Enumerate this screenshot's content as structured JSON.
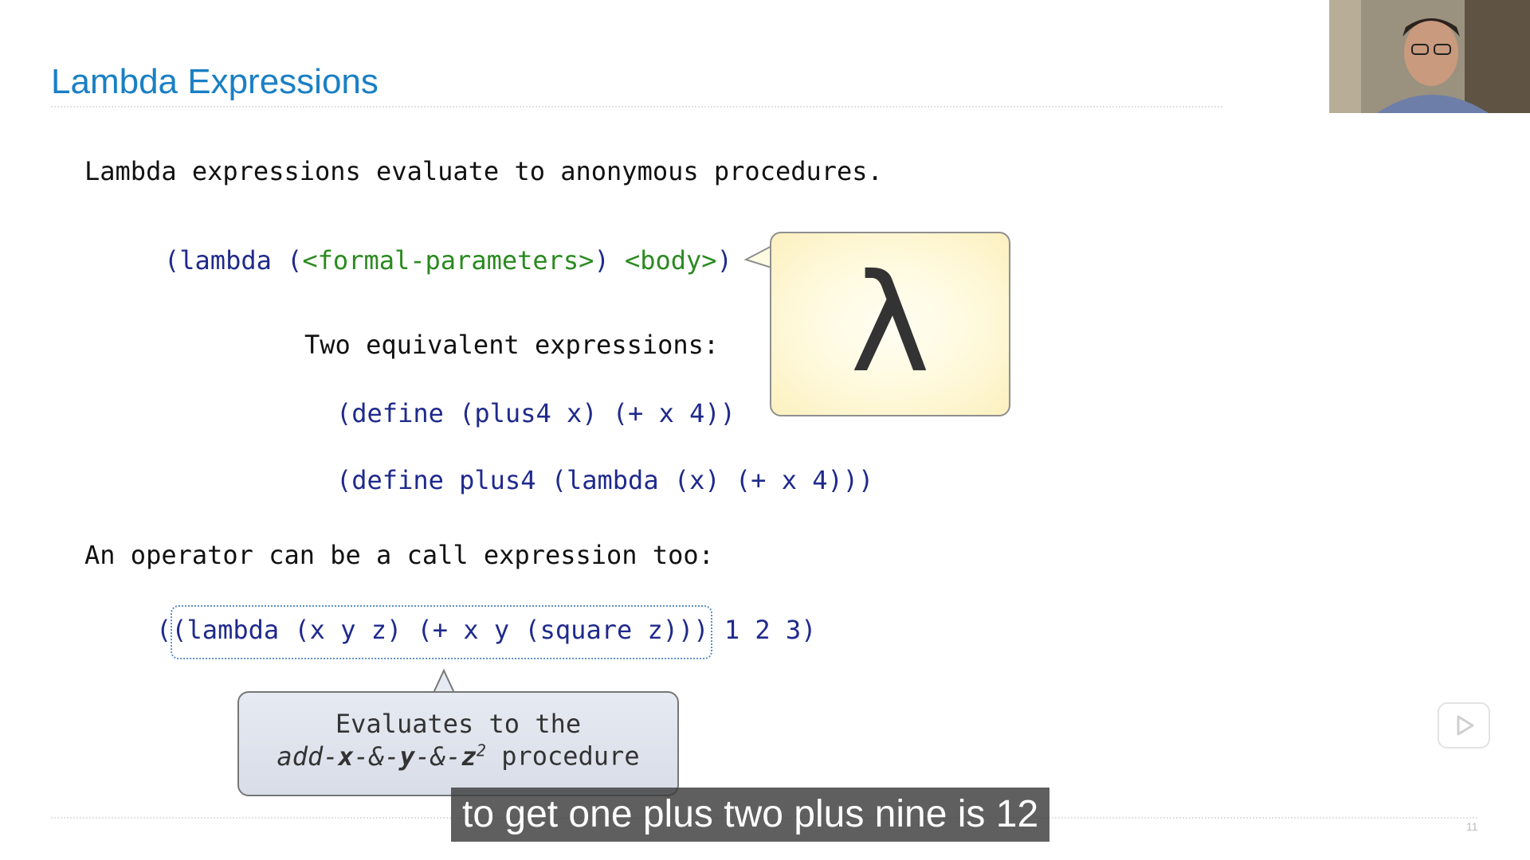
{
  "slide": {
    "title": "Lambda Expressions",
    "intro": "Lambda expressions evaluate to anonymous procedures.",
    "syntax": {
      "open": "(lambda (",
      "params": "<formal-parameters>",
      "mid": ") ",
      "body": "<body>",
      "close": ")"
    },
    "equivalent_heading": "Two equivalent expressions:",
    "expr_define": "(define (plus4 x) (+ x 4))",
    "expr_define_lambda": "(define plus4 (lambda (x) (+ x 4)))",
    "operator_heading": "An operator can be a call expression too:",
    "call_outer_open": "(",
    "call_operator": "(lambda (x y z) (+ x y (square z)))",
    "call_args": " 1 2 3)",
    "lambda_symbol": "λ",
    "evaluates_line1": "Evaluates to the",
    "evaluates_proc_parts": {
      "a": "add-",
      "b": "x",
      "c": "-&-",
      "d": "y",
      "e": "-&-",
      "f": "z",
      "sup": "2"
    },
    "evaluates_tail": " procedure",
    "page_number": "11"
  },
  "video": {
    "subtitle": "to get one plus two plus nine is 12"
  },
  "colors": {
    "title": "#1a7fc4",
    "code_blue": "#1f2a8c",
    "code_green": "#2a8a1f",
    "callout_yellow": "#fff9db",
    "callout_blue": "#dde2ec"
  },
  "icons": [
    "lambda-symbol",
    "play-icon",
    "webcam-feed"
  ]
}
